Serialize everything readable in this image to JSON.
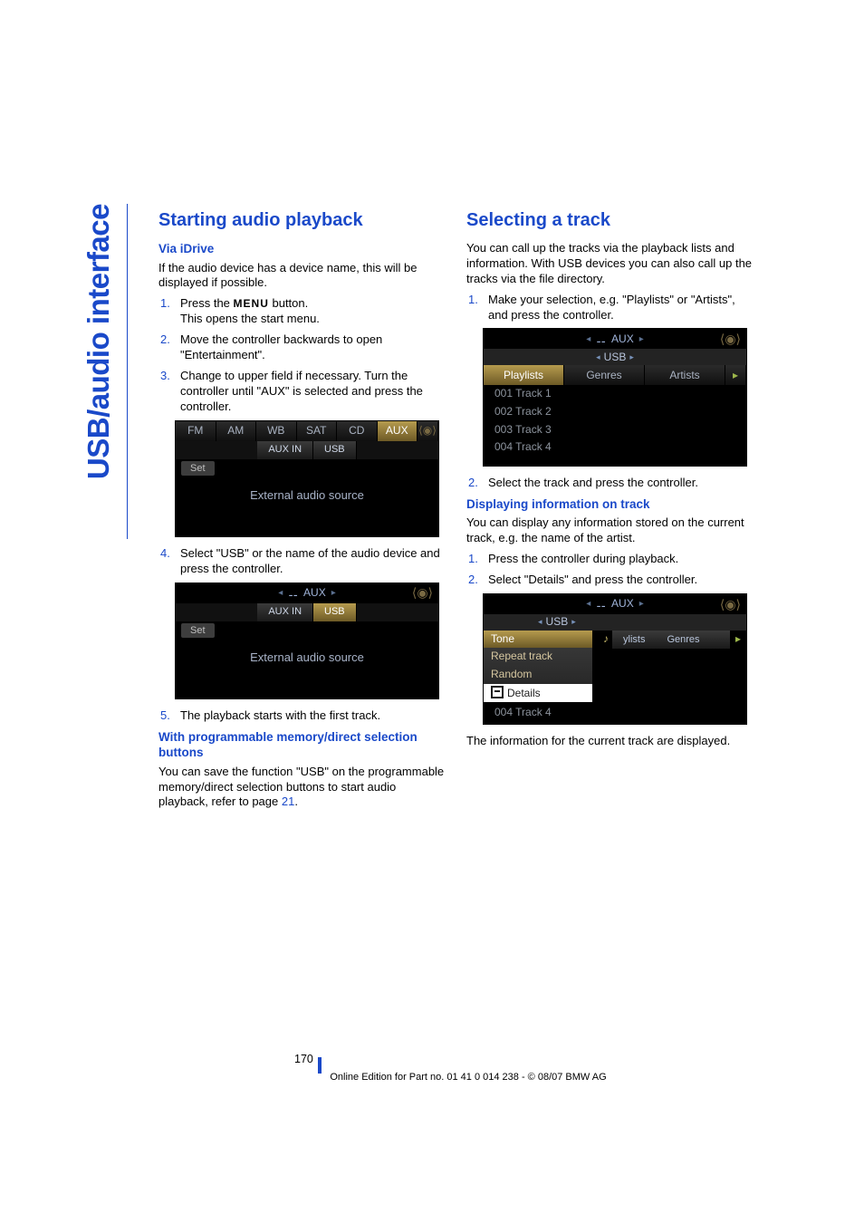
{
  "sideTab": "USB/audio interface",
  "left": {
    "h1": "Starting audio playback",
    "h2a": "Via iDrive",
    "p1": "If the audio device has a device name, this will be displayed if possible.",
    "step1a": "Press the ",
    "step1menu": "MENU",
    "step1b": " button.",
    "step1line2": "This opens the start menu.",
    "step2": "Move the controller backwards to open \"Entertainment\".",
    "step3": "Change to upper field if necessary. Turn the controller until \"AUX\" is selected and press the controller.",
    "shot1": {
      "tabs": [
        "FM",
        "AM",
        "WB",
        "SAT",
        "CD",
        "AUX"
      ],
      "sub": [
        "AUX IN",
        "USB"
      ],
      "set": "Set",
      "line": "External audio source"
    },
    "step4": "Select \"USB\" or the name of the audio device and press the controller.",
    "shot2": {
      "top": "AUX",
      "sub": [
        "AUX IN",
        "USB"
      ],
      "set": "Set",
      "line": "External audio source"
    },
    "step5": "The playback starts with the first track.",
    "h2b": "With programmable memory/direct selection buttons",
    "p2a": "You can save the function \"USB\" on the programmable memory/direct selection buttons to start audio playback, refer to page ",
    "p2ref": "21",
    "p2b": "."
  },
  "right": {
    "h1": "Selecting a track",
    "p1": "You can call up the tracks via the playback lists and information. With USB devices you can also call up the tracks via the file directory.",
    "step1": "Make your selection, e.g. \"Playlists\" or \"Artists\", and press the controller.",
    "shot1": {
      "top": "AUX",
      "sub": "USB",
      "tabs": [
        "Playlists",
        "Genres",
        "Artists"
      ],
      "rows": [
        "001 Track 1",
        "002 Track 2",
        "003 Track 3",
        "004 Track 4"
      ]
    },
    "step2": "Select the track and press the controller.",
    "h2": "Displaying information on track",
    "p2": "You can display any information stored on the current track, e.g. the name of the artist.",
    "d_step1": "Press the controller during playback.",
    "d_step2": "Select \"Details\" and press the controller.",
    "shot2": {
      "top": "AUX",
      "sub": "USB",
      "menu": [
        "Tone",
        "Repeat track",
        "Random",
        "Details"
      ],
      "right_tabs": [
        "ylists",
        "Genres"
      ],
      "bottom": "004 Track 4"
    },
    "p3": "The information for the current track are displayed."
  },
  "footer": {
    "page": "170",
    "line": "Online Edition for Part no. 01 41 0 014 238 - © 08/07 BMW AG"
  }
}
